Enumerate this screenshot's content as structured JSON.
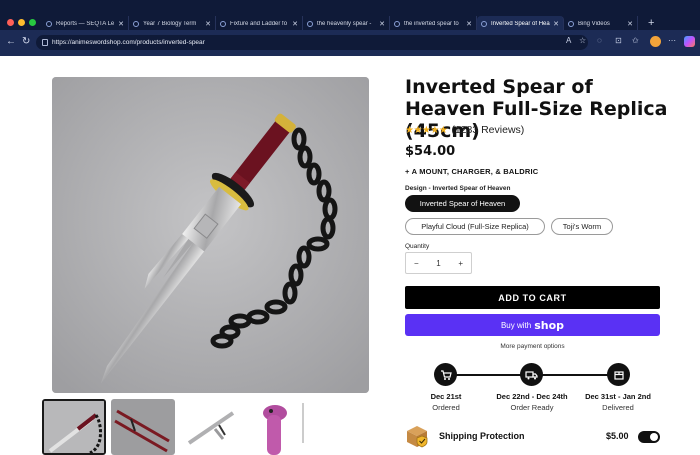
{
  "browser": {
    "tabs": [
      {
        "label": "Reports — SEQTA Le",
        "active": false
      },
      {
        "label": "Year 7 Biology Term",
        "active": false
      },
      {
        "label": "Fixture and Ladder fo",
        "active": false
      },
      {
        "label": "the heavenly spear -",
        "active": false
      },
      {
        "label": "the inverted spear to",
        "active": false
      },
      {
        "label": "Inverted Spear of Hea",
        "active": true
      },
      {
        "label": "Bing Videos",
        "active": false
      }
    ],
    "new_tab": "+",
    "url": "https://animeswordshop.com/products/inverted-spear"
  },
  "product": {
    "title": "Inverted Spear of Heaven Full-Size Replica (45cm)",
    "stars": "★★★★★",
    "rating": 5,
    "reviews": "(1283 Reviews)",
    "price": "$54.00",
    "addon": "+ A MOUNT, CHARGER, & BALDRIC",
    "design_label": "Design - Inverted Spear of Heaven",
    "design_options": [
      {
        "label": "Inverted Spear of Heaven",
        "selected": true
      },
      {
        "label": "Playful Cloud (Full-Size Replica)",
        "selected": false
      },
      {
        "label": "Toji's Worm",
        "selected": false
      }
    ],
    "quantity_label": "Quantity",
    "quantity": "1",
    "minus": "−",
    "plus": "+",
    "add_to_cart": "ADD TO CART",
    "buy_with": "Buy with",
    "buy_brand": "shop",
    "more_payment": "More payment options"
  },
  "delivery": [
    {
      "date": "Dec 21st",
      "status": "Ordered",
      "icon": "cart-icon"
    },
    {
      "date": "Dec 22nd - Dec 24th",
      "status": "Order Ready",
      "icon": "truck-icon"
    },
    {
      "date": "Dec 31st - Jan 2nd",
      "status": "Delivered",
      "icon": "package-icon"
    }
  ],
  "shipping": {
    "label": "Shipping Protection",
    "price": "$5.00",
    "enabled": true
  },
  "colors": {
    "chrome_dark": "#0f1a38",
    "chrome_bar": "#1c2b55",
    "shop_purple": "#5a31f4",
    "star_gold": "#f2b01e"
  }
}
